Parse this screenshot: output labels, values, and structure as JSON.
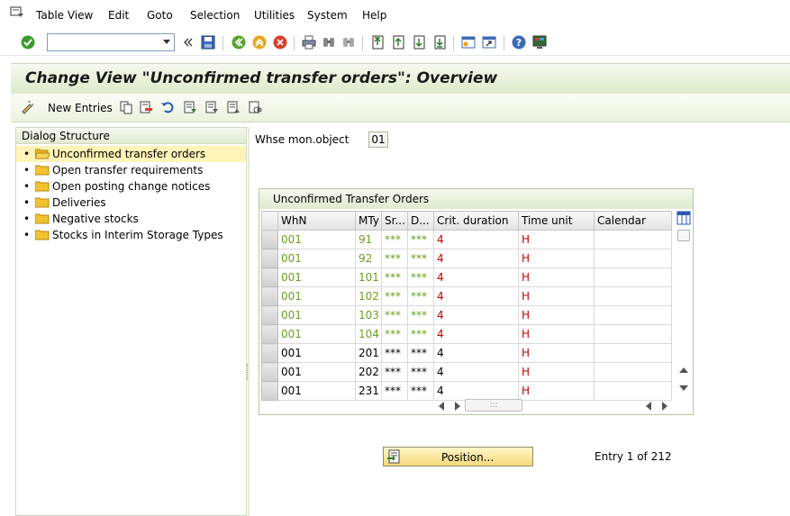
{
  "menubar": {
    "items": [
      {
        "label": "Table View"
      },
      {
        "label": "Edit"
      },
      {
        "label": "Goto"
      },
      {
        "label": "Selection"
      },
      {
        "label": "Utilities"
      },
      {
        "label": "System"
      },
      {
        "label": "Help"
      }
    ]
  },
  "toolbar": {
    "command_field_value": "",
    "icons": [
      "enter-icon",
      "back-arrows-icon",
      "save-icon",
      "back-icon",
      "exit-icon",
      "cancel-icon",
      "print-icon",
      "find-icon",
      "find-next-icon",
      "first-page-icon",
      "previous-page-icon",
      "next-page-icon",
      "last-page-icon",
      "new-session-icon",
      "shortcut-icon",
      "help-icon",
      "customize-layout-icon"
    ]
  },
  "title": "Change View \"Unconfirmed transfer orders\": Overview",
  "app_toolbar": {
    "new_entries_label": "New Entries"
  },
  "dialog_structure": {
    "header": "Dialog Structure",
    "items": [
      {
        "label": "Unconfirmed transfer orders",
        "selected": true
      },
      {
        "label": "Open transfer requirements"
      },
      {
        "label": "Open posting change notices"
      },
      {
        "label": "Deliveries"
      },
      {
        "label": "Negative stocks"
      },
      {
        "label": "Stocks in Interim Storage Types"
      }
    ]
  },
  "whse": {
    "label": "Whse mon.object",
    "value": "01"
  },
  "table": {
    "title": "Unconfirmed Transfer Orders",
    "columns": [
      "WhN",
      "MTy",
      "Sr...",
      "D...",
      "Crit. duration",
      "Time unit",
      "Calendar"
    ],
    "rows": [
      {
        "whn": "001",
        "mty": "91",
        "sr": "***",
        "d": "***",
        "crit": "4",
        "unit": "H",
        "cal": "",
        "green": true
      },
      {
        "whn": "001",
        "mty": "92",
        "sr": "***",
        "d": "***",
        "crit": "4",
        "unit": "H",
        "cal": "",
        "green": true
      },
      {
        "whn": "001",
        "mty": "101",
        "sr": "***",
        "d": "***",
        "crit": "4",
        "unit": "H",
        "cal": "",
        "green": true
      },
      {
        "whn": "001",
        "mty": "102",
        "sr": "***",
        "d": "***",
        "crit": "4",
        "unit": "H",
        "cal": "",
        "green": true
      },
      {
        "whn": "001",
        "mty": "103",
        "sr": "***",
        "d": "***",
        "crit": "4",
        "unit": "H",
        "cal": "",
        "green": true
      },
      {
        "whn": "001",
        "mty": "104",
        "sr": "***",
        "d": "***",
        "crit": "4",
        "unit": "H",
        "cal": "",
        "green": true
      },
      {
        "whn": "001",
        "mty": "201",
        "sr": "***",
        "d": "***",
        "crit": "4",
        "unit": "H",
        "cal": "",
        "green": false
      },
      {
        "whn": "001",
        "mty": "202",
        "sr": "***",
        "d": "***",
        "crit": "4",
        "unit": "H",
        "cal": "",
        "green": false
      },
      {
        "whn": "001",
        "mty": "231",
        "sr": "***",
        "d": "***",
        "crit": "4",
        "unit": "H",
        "cal": "",
        "green": false
      }
    ]
  },
  "position_button_label": "Position...",
  "entry_info": "Entry 1 of 212",
  "colors": {
    "title_bg": "#dce9c8",
    "green_text": "#6aa01f",
    "red_text": "#c00000",
    "selected_tree": "#fff3b8",
    "position_button": "#f7d97a"
  }
}
